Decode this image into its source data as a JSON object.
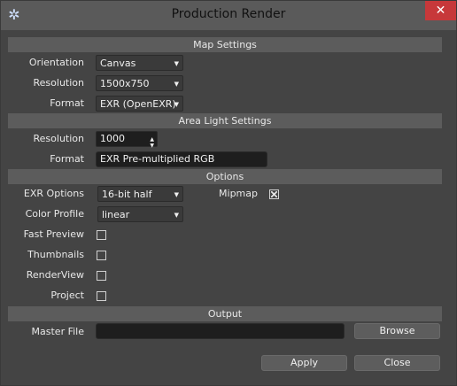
{
  "window": {
    "title": "Production Render",
    "close_glyph": "✕",
    "app_icon": "gear-icon"
  },
  "map_settings": {
    "header": "Map Settings",
    "orientation_label": "Orientation",
    "orientation_value": "Canvas",
    "resolution_label": "Resolution",
    "resolution_value": "1500x750",
    "format_label": "Format",
    "format_value": "EXR (OpenEXR)"
  },
  "area_light_settings": {
    "header": "Area Light Settings",
    "resolution_label": "Resolution",
    "resolution_value": "1000",
    "format_label": "Format",
    "format_value": "EXR Pre-multiplied RGB"
  },
  "options": {
    "header": "Options",
    "exr_options_label": "EXR Options",
    "exr_options_value": "16-bit half",
    "mipmap_label": "Mipmap",
    "mipmap_checked": true,
    "color_profile_label": "Color Profile",
    "color_profile_value": "linear",
    "fast_preview_label": "Fast Preview",
    "fast_preview_checked": false,
    "thumbnails_label": "Thumbnails",
    "thumbnails_checked": false,
    "renderview_label": "RenderView",
    "renderview_checked": false,
    "project_label": "Project",
    "project_checked": false
  },
  "output": {
    "header": "Output",
    "master_file_label": "Master File",
    "master_file_value": "",
    "browse_label": "Browse"
  },
  "footer": {
    "apply_label": "Apply",
    "close_label": "Close"
  },
  "colors": {
    "close_button": "#c7383a",
    "section_bg": "#5c5c5c",
    "panel_bg": "#444444"
  }
}
